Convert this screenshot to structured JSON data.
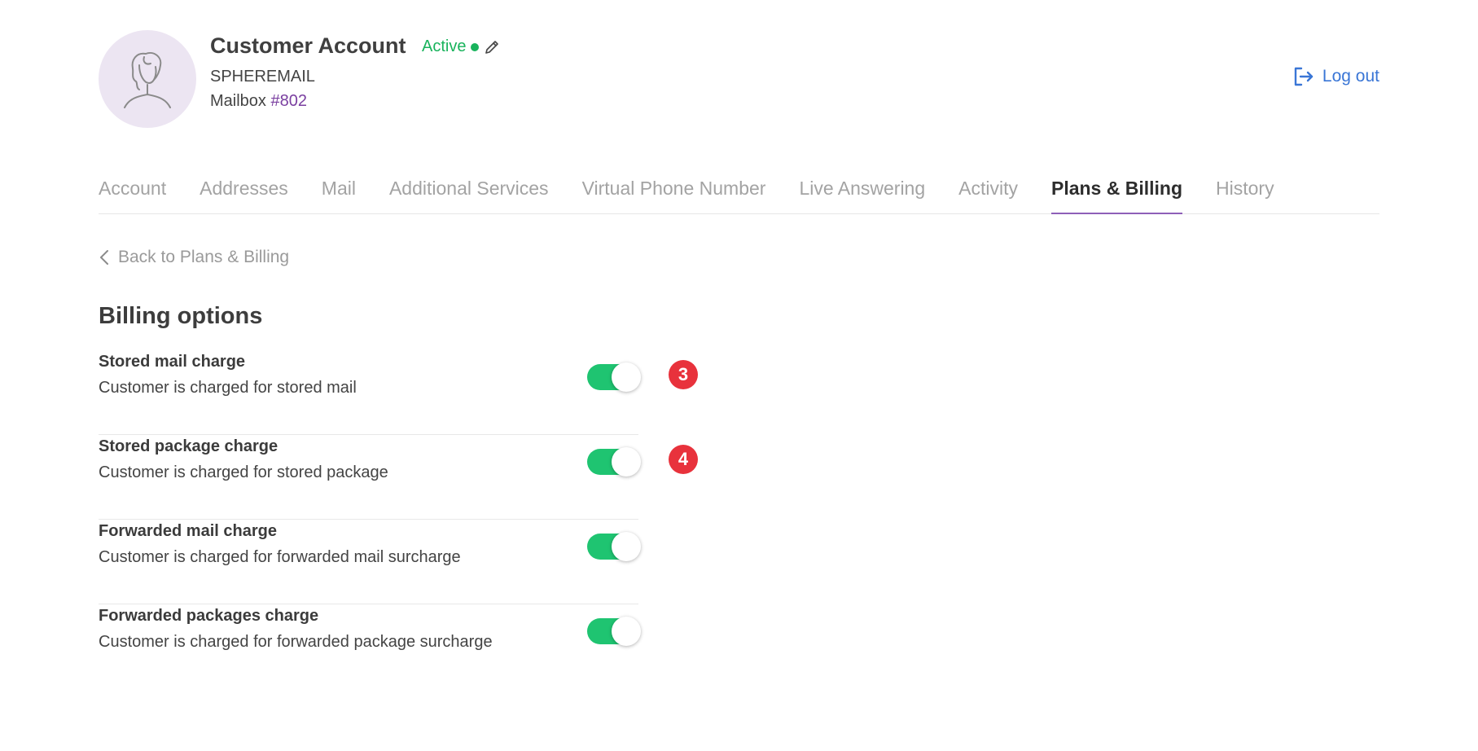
{
  "header": {
    "account_name": "Customer Account",
    "status": "Active",
    "status_color": "#19b35c",
    "company": "SPHEREMAIL",
    "mailbox_label": "Mailbox",
    "mailbox_number": "#802",
    "logout_label": "Log out",
    "avatar_icon": "person-outline-icon",
    "edit_icon": "pencil-icon"
  },
  "tabs": [
    {
      "label": "Account",
      "active": false
    },
    {
      "label": "Addresses",
      "active": false
    },
    {
      "label": "Mail",
      "active": false
    },
    {
      "label": "Additional Services",
      "active": false
    },
    {
      "label": "Virtual Phone Number",
      "active": false
    },
    {
      "label": "Live Answering",
      "active": false
    },
    {
      "label": "Activity",
      "active": false
    },
    {
      "label": "Plans & Billing",
      "active": true
    },
    {
      "label": "History",
      "active": false
    }
  ],
  "back_link": "Back to Plans & Billing",
  "section_title": "Billing options",
  "options": [
    {
      "title": "Stored mail charge",
      "description": "Customer is charged for stored mail",
      "enabled": true,
      "badge": "3"
    },
    {
      "title": "Stored package charge",
      "description": "Customer is charged for stored package",
      "enabled": true,
      "badge": "4"
    },
    {
      "title": "Forwarded mail charge",
      "description": "Customer is charged for forwarded mail surcharge",
      "enabled": true,
      "badge": ""
    },
    {
      "title": "Forwarded packages charge",
      "description": "Customer is charged for forwarded package surcharge",
      "enabled": true,
      "badge": ""
    }
  ],
  "colors": {
    "toggle_on": "#1fc471",
    "badge": "#e8323c",
    "accent": "#8e5fb8",
    "link": "#3a76d6"
  }
}
